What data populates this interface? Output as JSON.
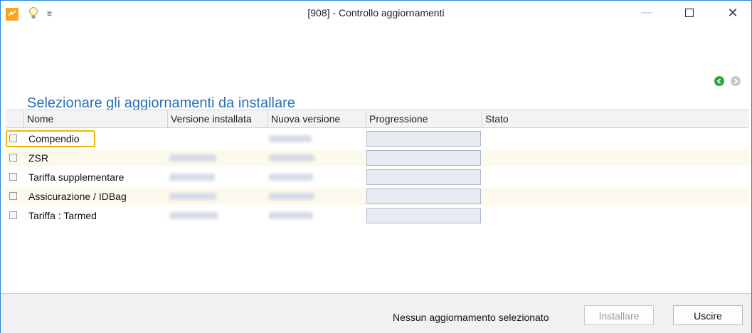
{
  "window": {
    "title": "[908] - Controllo aggiornamenti",
    "minimize_icon": "minimize-icon",
    "maximize_icon": "maximize-icon",
    "close_icon": "close-icon"
  },
  "heading": "Selezionare gli aggiornamenti da installare",
  "grid": {
    "columns": [
      "Nome",
      "Versione installata",
      "Nuova versione",
      "Progressione",
      "Stato"
    ],
    "rows": [
      {
        "name": "Compendio",
        "checked": false
      },
      {
        "name": "ZSR",
        "checked": false
      },
      {
        "name": "Tariffa supplementare",
        "checked": false
      },
      {
        "name": "Assicurazione / IDBag",
        "checked": false
      },
      {
        "name": "Tariffa : Tarmed",
        "checked": false
      }
    ]
  },
  "footer": {
    "status": "Nessun aggiornamento selezionato",
    "install_label": "Installare",
    "exit_label": "Uscire"
  },
  "colors": {
    "heading": "#2a6ebb",
    "highlight": "#f2b705",
    "row_alt": "#fdf9ec"
  }
}
